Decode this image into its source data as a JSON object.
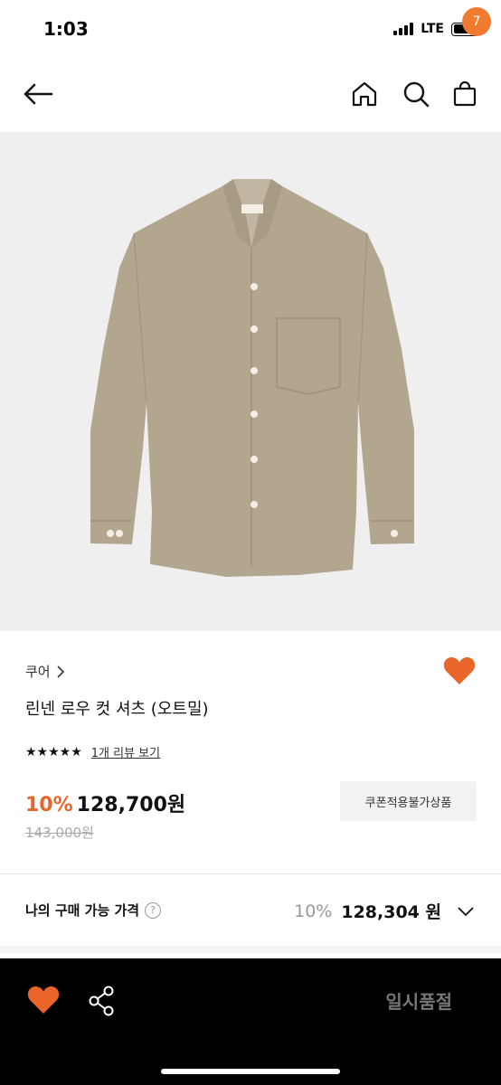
{
  "status_bar": {
    "time": "1:03",
    "network": "LTE"
  },
  "nav": {
    "cart_count": "7"
  },
  "product": {
    "brand": "쿠어",
    "name": "린넨 로우 컷 셔츠 (오트밀)",
    "stars": "★★★★★",
    "review_link": "1개 리뷰 보기",
    "discount": "10%",
    "price": "128,700원",
    "original_price": "143,000원",
    "coupon_label": "쿠폰적용불가상품"
  },
  "my_price": {
    "label": "나의 구매 가능 가격",
    "help": "?",
    "discount": "10%",
    "amount": "128,304 원"
  },
  "bottom_bar": {
    "soldout_label": "일시품절"
  },
  "colors": {
    "accent": "#e9652a",
    "badge": "#f07a2d",
    "heart": "#e9652a",
    "image_bg": "#efefef"
  },
  "icons": [
    "arrow-left-icon",
    "home-icon",
    "search-icon",
    "cart-icon",
    "chevron-right-icon",
    "heart-icon",
    "help-icon",
    "chevron-down-icon",
    "share-icon"
  ]
}
